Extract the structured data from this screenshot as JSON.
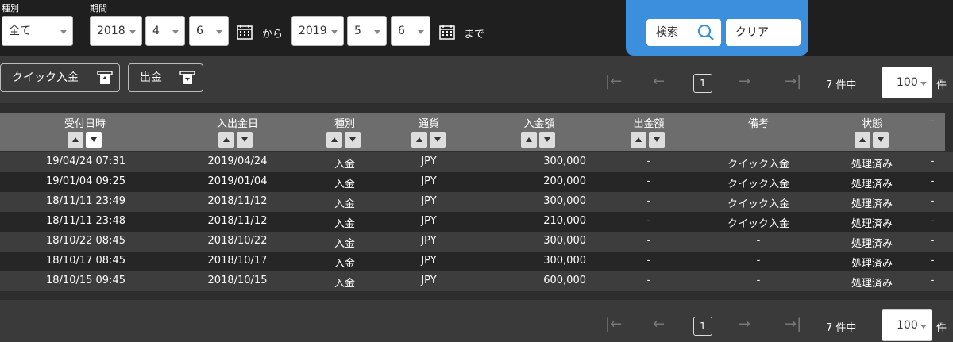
{
  "filters": {
    "type_label": "種別",
    "type_value": "全て",
    "period_label": "期間",
    "from": {
      "year": "2018",
      "month": "4",
      "day": "6"
    },
    "from_text": "から",
    "to": {
      "year": "2019",
      "month": "5",
      "day": "6"
    },
    "to_text": "まで",
    "search_label": "検索",
    "clear_label": "クリア"
  },
  "actions": {
    "quick_deposit": "クイック入金",
    "withdraw": "出金"
  },
  "pager": {
    "page": "1",
    "count": "7",
    "count_suffix": "件中",
    "per_page": "100",
    "unit": "件"
  },
  "table": {
    "headers": [
      "受付日時",
      "入出金日",
      "種別",
      "通貨",
      "入金額",
      "出金額",
      "備考",
      "状態",
      "-"
    ],
    "rows": [
      [
        "19/04/24 07:31",
        "2019/04/24",
        "入金",
        "JPY",
        "300,000",
        "-",
        "クイック入金",
        "処理済み",
        "-"
      ],
      [
        "19/01/04 09:25",
        "2019/01/04",
        "入金",
        "JPY",
        "200,000",
        "-",
        "クイック入金",
        "処理済み",
        "-"
      ],
      [
        "18/11/11 23:49",
        "2018/11/12",
        "入金",
        "JPY",
        "300,000",
        "-",
        "クイック入金",
        "処理済み",
        "-"
      ],
      [
        "18/11/11 23:48",
        "2018/11/12",
        "入金",
        "JPY",
        "210,000",
        "-",
        "クイック入金",
        "処理済み",
        "-"
      ],
      [
        "18/10/22 08:45",
        "2018/10/22",
        "入金",
        "JPY",
        "300,000",
        "-",
        "-",
        "処理済み",
        "-"
      ],
      [
        "18/10/17 08:45",
        "2018/10/17",
        "入金",
        "JPY",
        "300,000",
        "-",
        "-",
        "処理済み",
        "-"
      ],
      [
        "18/10/15 09:45",
        "2018/10/15",
        "入金",
        "JPY",
        "600,000",
        "-",
        "-",
        "処理済み",
        "-"
      ]
    ]
  },
  "icons": {
    "calendar": "calendar-icon",
    "search": "search-icon",
    "first": "first-page-icon",
    "prev": "prev-page-icon",
    "next": "next-page-icon",
    "last": "last-page-icon"
  }
}
